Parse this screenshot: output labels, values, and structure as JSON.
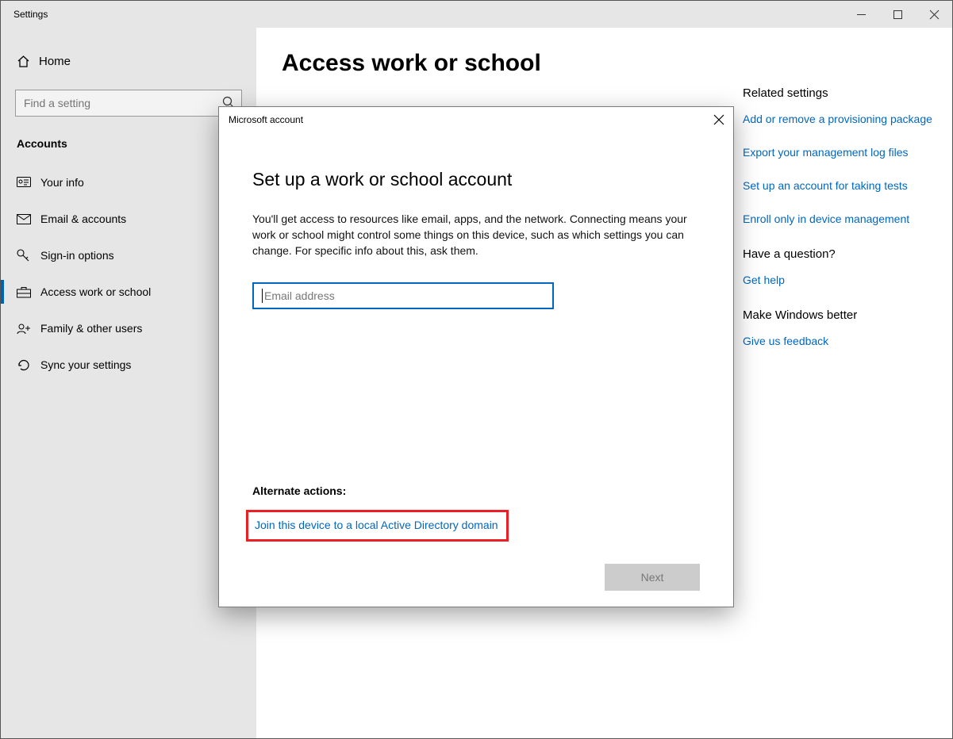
{
  "window": {
    "title": "Settings"
  },
  "sidebar": {
    "home": "Home",
    "search_placeholder": "Find a setting",
    "section": "Accounts",
    "items": [
      {
        "label": "Your info"
      },
      {
        "label": "Email & accounts"
      },
      {
        "label": "Sign-in options"
      },
      {
        "label": "Access work or school"
      },
      {
        "label": "Family & other users"
      },
      {
        "label": "Sync your settings"
      }
    ]
  },
  "page": {
    "title": "Access work or school"
  },
  "right": {
    "related_h": "Related settings",
    "links": [
      "Add or remove a provisioning package",
      "Export your management log files",
      "Set up an account for taking tests",
      "Enroll only in device management"
    ],
    "question_h": "Have a question?",
    "help": "Get help",
    "better_h": "Make Windows better",
    "feedback": "Give us feedback"
  },
  "dialog": {
    "title": "Microsoft account",
    "heading": "Set up a work or school account",
    "desc": "You'll get access to resources like email, apps, and the network. Connecting means your work or school might control some things on this device, such as which settings you can change. For specific info about this, ask them.",
    "email_placeholder": "Email address",
    "alt_h": "Alternate actions:",
    "alt_link": "Join this device to a local Active Directory domain",
    "next": "Next"
  }
}
